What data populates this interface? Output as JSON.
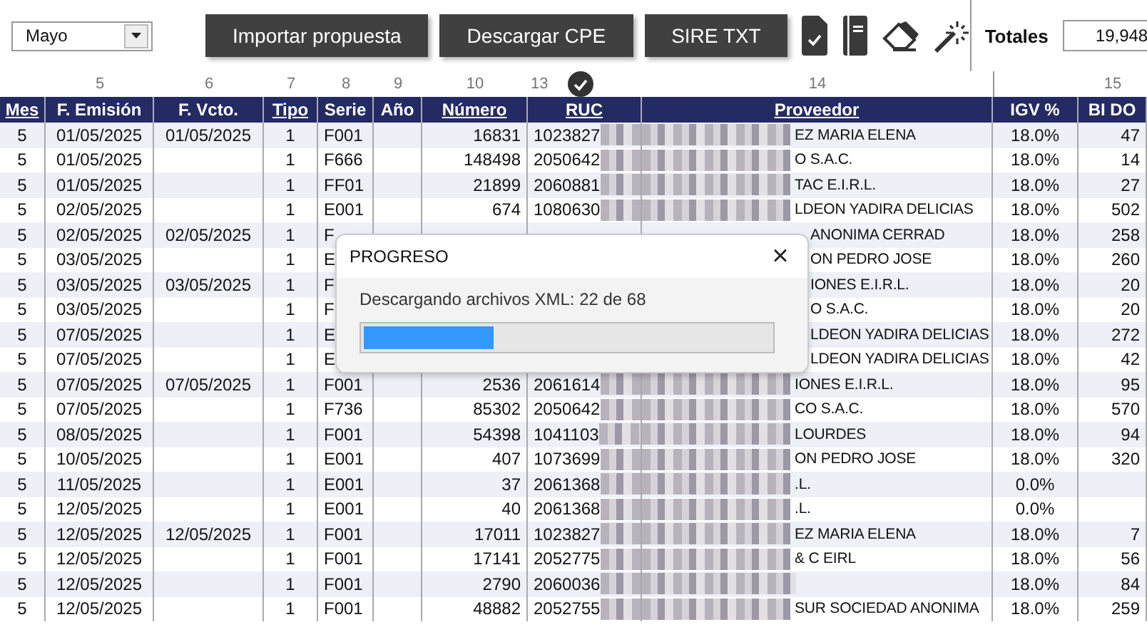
{
  "month_select": {
    "value": "Mayo"
  },
  "toolbar": {
    "buttons": [
      "Importar propuesta",
      "Descargar CPE",
      "SIRE TXT"
    ]
  },
  "totals": {
    "label": "Totales",
    "value": "19,948"
  },
  "table": {
    "columns": [
      {
        "label": "Mes",
        "underlined": true
      },
      {
        "label": "F. Emisión",
        "number": "5",
        "underlined": false
      },
      {
        "label": "F. Vcto.",
        "number": "6",
        "underlined": false
      },
      {
        "label": "Tipo",
        "number": "7",
        "underlined": true
      },
      {
        "label": "Serie",
        "number": "8",
        "underlined": false
      },
      {
        "label": "Año",
        "number": "9",
        "underlined": false
      },
      {
        "label": "Número",
        "number": "10",
        "underlined": true
      },
      {
        "label": "RUC",
        "number": "13",
        "check_mark": true,
        "underlined": true
      },
      {
        "label": "Proveedor",
        "number": "14",
        "underlined": true
      },
      {
        "label": "IGV %",
        "underlined": false
      },
      {
        "label": "BI DO",
        "number": "15",
        "underlined": false
      }
    ],
    "rows": [
      {
        "mes": "5",
        "emision": "01/05/2025",
        "vcto": "01/05/2025",
        "tipo": "1",
        "serie": "F001",
        "numero": "16831",
        "ruc": "1023827",
        "proveedor": "EZ MARIA ELENA",
        "igv": "18.0%",
        "bi": "47"
      },
      {
        "mes": "5",
        "emision": "01/05/2025",
        "tipo": "1",
        "serie": "F666",
        "numero": "148498",
        "ruc": "2050642",
        "proveedor": "O S.A.C.",
        "igv": "18.0%",
        "bi": "14"
      },
      {
        "mes": "5",
        "emision": "01/05/2025",
        "tipo": "1",
        "serie": "FF01",
        "numero": "21899",
        "ruc": "2060881",
        "proveedor": "TAC E.I.R.L.",
        "igv": "18.0%",
        "bi": "27"
      },
      {
        "mes": "5",
        "emision": "02/05/2025",
        "tipo": "1",
        "serie": "E001",
        "numero": "674",
        "ruc": "1080630",
        "proveedor": "LDEON YADIRA DELICIAS",
        "igv": "18.0%",
        "bi": "502"
      },
      {
        "mes": "5",
        "emision": "02/05/2025",
        "vcto": "02/05/2025",
        "tipo": "1",
        "serie": "F",
        "proveedor": "ANONIMA CERRAD",
        "igv": "18.0%",
        "bi": "258"
      },
      {
        "mes": "5",
        "emision": "03/05/2025",
        "tipo": "1",
        "serie": "E",
        "proveedor": "ON PEDRO JOSE",
        "igv": "18.0%",
        "bi": "260"
      },
      {
        "mes": "5",
        "emision": "03/05/2025",
        "vcto": "03/05/2025",
        "tipo": "1",
        "serie": "F",
        "proveedor": "IONES E.I.R.L.",
        "igv": "18.0%",
        "bi": "20"
      },
      {
        "mes": "5",
        "emision": "03/05/2025",
        "tipo": "1",
        "serie": "F",
        "proveedor": "O S.A.C.",
        "igv": "18.0%",
        "bi": "20"
      },
      {
        "mes": "5",
        "emision": "07/05/2025",
        "tipo": "1",
        "serie": "E",
        "proveedor": "LDEON YADIRA DELICIAS",
        "igv": "18.0%",
        "bi": "272"
      },
      {
        "mes": "5",
        "emision": "07/05/2025",
        "tipo": "1",
        "serie": "E",
        "proveedor": "LDEON YADIRA DELICIAS",
        "igv": "18.0%",
        "bi": "42"
      },
      {
        "mes": "5",
        "emision": "07/05/2025",
        "vcto": "07/05/2025",
        "tipo": "1",
        "serie": "F001",
        "numero": "2536",
        "ruc": "2061614",
        "proveedor": "IONES E.I.R.L.",
        "igv": "18.0%",
        "bi": "95"
      },
      {
        "mes": "5",
        "emision": "07/05/2025",
        "tipo": "1",
        "serie": "F736",
        "numero": "85302",
        "ruc": "2050642",
        "proveedor": "CO S.A.C.",
        "igv": "18.0%",
        "bi": "570"
      },
      {
        "mes": "5",
        "emision": "08/05/2025",
        "tipo": "1",
        "serie": "F001",
        "numero": "54398",
        "ruc": "1041103",
        "proveedor": "LOURDES",
        "igv": "18.0%",
        "bi": "94"
      },
      {
        "mes": "5",
        "emision": "10/05/2025",
        "tipo": "1",
        "serie": "E001",
        "numero": "407",
        "ruc": "1073699",
        "proveedor": "ON PEDRO JOSE",
        "igv": "18.0%",
        "bi": "320"
      },
      {
        "mes": "5",
        "emision": "11/05/2025",
        "tipo": "1",
        "serie": "E001",
        "numero": "37",
        "ruc": "2061368",
        "proveedor": ".L.",
        "igv": "0.0%"
      },
      {
        "mes": "5",
        "emision": "12/05/2025",
        "tipo": "1",
        "serie": "E001",
        "numero": "40",
        "ruc": "2061368",
        "proveedor": ".L.",
        "igv": "0.0%"
      },
      {
        "mes": "5",
        "emision": "12/05/2025",
        "vcto": "12/05/2025",
        "tipo": "1",
        "serie": "F001",
        "numero": "17011",
        "ruc": "1023827",
        "proveedor": "EZ MARIA ELENA",
        "igv": "18.0%",
        "bi": "7"
      },
      {
        "mes": "5",
        "emision": "12/05/2025",
        "tipo": "1",
        "serie": "F001",
        "numero": "17141",
        "ruc": "2052775",
        "proveedor": "& C EIRL",
        "igv": "18.0%",
        "bi": "56"
      },
      {
        "mes": "5",
        "emision": "12/05/2025",
        "tipo": "1",
        "serie": "F001",
        "numero": "2790",
        "ruc": "2060036",
        "igv": "18.0%",
        "bi": "84"
      },
      {
        "mes": "5",
        "emision": "12/05/2025",
        "tipo": "1",
        "serie": "F001",
        "numero": "48882",
        "ruc": "2052755",
        "proveedor": "SUR SOCIEDAD ANONIMA",
        "igv": "18.0%",
        "bi": "259"
      }
    ]
  },
  "dialog": {
    "title": "PROGRESO",
    "close": "×",
    "message": "Descargando archivos XML: 22 de 68",
    "progress": {
      "level": 0.32
    }
  }
}
